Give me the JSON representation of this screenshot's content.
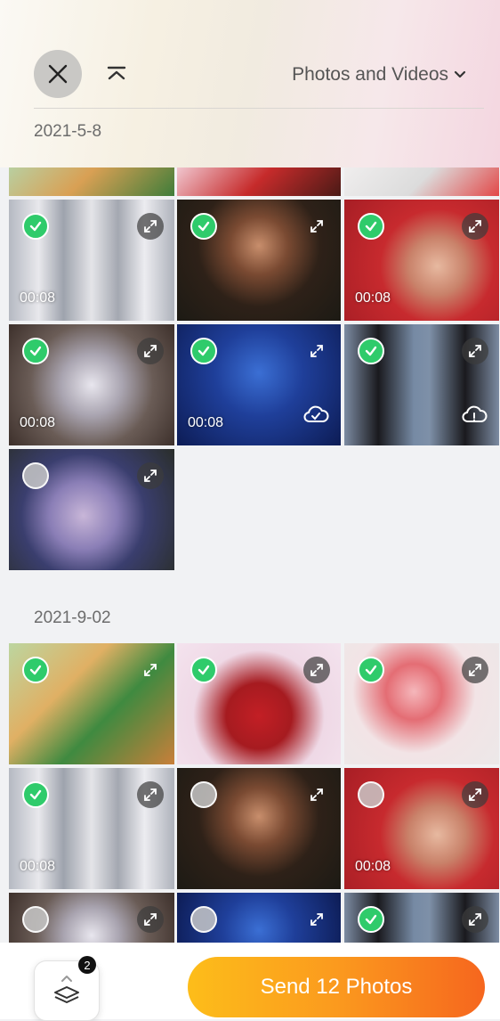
{
  "header": {
    "filter_label": "Photos and Videos",
    "date_label": "2021-5-8"
  },
  "sections": [
    {
      "date": "2021-9-02"
    }
  ],
  "tiles": [
    {
      "selected": true,
      "duration": "00:08",
      "cloud": false
    },
    {
      "selected": true,
      "duration": "",
      "cloud": false
    },
    {
      "selected": true,
      "duration": "00:08",
      "cloud": false
    },
    {
      "selected": true,
      "duration": "00:08",
      "cloud": false
    },
    {
      "selected": true,
      "duration": "00:08",
      "cloud": true
    },
    {
      "selected": true,
      "duration": "",
      "cloud": true
    },
    {
      "selected": false,
      "duration": "",
      "cloud": false
    },
    {
      "selected": true,
      "duration": "",
      "cloud": false
    },
    {
      "selected": true,
      "duration": "",
      "cloud": false
    },
    {
      "selected": true,
      "duration": "",
      "cloud": false
    },
    {
      "selected": true,
      "duration": "00:08",
      "cloud": false
    },
    {
      "selected": false,
      "duration": "",
      "cloud": false
    },
    {
      "selected": false,
      "duration": "00:08",
      "cloud": false
    },
    {
      "selected": false,
      "duration": "",
      "cloud": false
    },
    {
      "selected": false,
      "duration": "",
      "cloud": false
    },
    {
      "selected": true,
      "duration": "",
      "cloud": false
    }
  ],
  "footer": {
    "layers_badge": "2",
    "send_label": "Send 12 Photos"
  },
  "colors": {
    "accent_start": "#fdbd1a",
    "accent_end": "#f6661e",
    "check_green": "#2fcb6b"
  },
  "icons": [
    "close-icon",
    "collapse-icon",
    "chevron-down-icon",
    "expand-icon",
    "cloud-icon",
    "cloud-error-icon",
    "layers-icon"
  ]
}
